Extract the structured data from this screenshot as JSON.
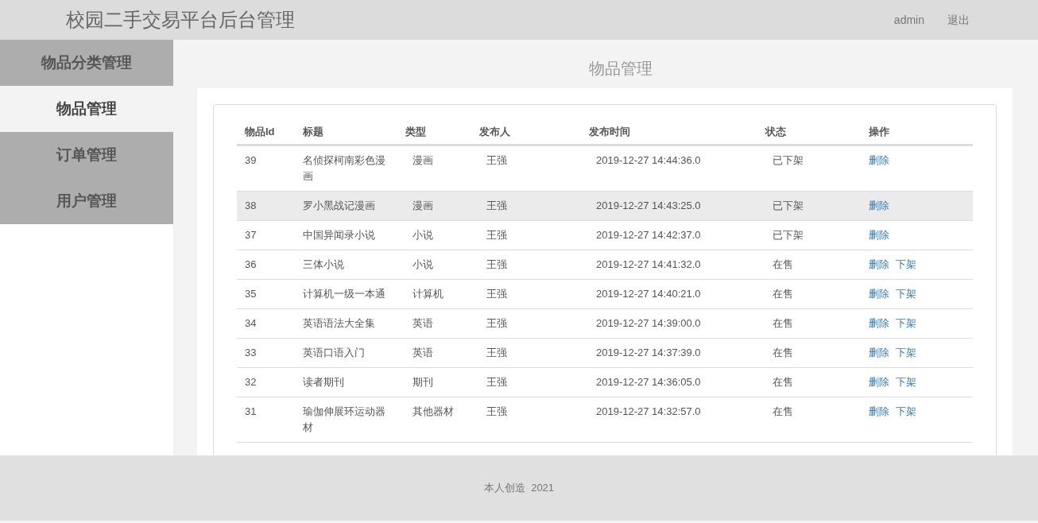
{
  "header": {
    "title": "校园二手交易平台后台管理",
    "user": "admin",
    "logout": "退出"
  },
  "sidebar": {
    "items": [
      {
        "label": "物品分类管理",
        "selected": false
      },
      {
        "label": "物品管理",
        "selected": true
      },
      {
        "label": "订单管理",
        "selected": false
      },
      {
        "label": "用户管理",
        "selected": false
      }
    ]
  },
  "page_title": "物品管理",
  "table": {
    "columns": [
      "物品Id",
      "标题",
      "类型",
      "发布人",
      "发布时间",
      "状态",
      "操作"
    ],
    "rows": [
      {
        "cells": [
          "39",
          "名侦探柯南彩色漫画",
          "漫画",
          "王强",
          "2019-12-27 14:44:36.0",
          "已下架"
        ],
        "actions": [
          "删除"
        ],
        "selected": false
      },
      {
        "cells": [
          "38",
          "罗小黑战记漫画",
          "漫画",
          "王强",
          "2019-12-27 14:43:25.0",
          "已下架"
        ],
        "actions": [
          "删除"
        ],
        "selected": true
      },
      {
        "cells": [
          "37",
          "中国异闻录小说",
          "小说",
          "王强",
          "2019-12-27 14:42:37.0",
          "已下架"
        ],
        "actions": [
          "删除"
        ],
        "selected": false
      },
      {
        "cells": [
          "36",
          "三体小说",
          "小说",
          "王强",
          "2019-12-27 14:41:32.0",
          "在售"
        ],
        "actions": [
          "删除",
          "下架"
        ],
        "selected": false
      },
      {
        "cells": [
          "35",
          "计算机一级一本通",
          "计算机",
          "王强",
          "2019-12-27 14:40:21.0",
          "在售"
        ],
        "actions": [
          "删除",
          "下架"
        ],
        "selected": false
      },
      {
        "cells": [
          "34",
          "英语语法大全集",
          "英语",
          "王强",
          "2019-12-27 14:39:00.0",
          "在售"
        ],
        "actions": [
          "删除",
          "下架"
        ],
        "selected": false
      },
      {
        "cells": [
          "33",
          "英语口语入门",
          "英语",
          "王强",
          "2019-12-27 14:37:39.0",
          "在售"
        ],
        "actions": [
          "删除",
          "下架"
        ],
        "selected": false
      },
      {
        "cells": [
          "32",
          "读者期刊",
          "期刊",
          "王强",
          "2019-12-27 14:36:05.0",
          "在售"
        ],
        "actions": [
          "删除",
          "下架"
        ],
        "selected": false
      },
      {
        "cells": [
          "31",
          "瑜伽伸展环运动器材",
          "其他器材",
          "王强",
          "2019-12-27 14:32:57.0",
          "在售"
        ],
        "actions": [
          "删除",
          "下架"
        ],
        "selected": false
      }
    ]
  },
  "footer": "本人创造  2021"
}
